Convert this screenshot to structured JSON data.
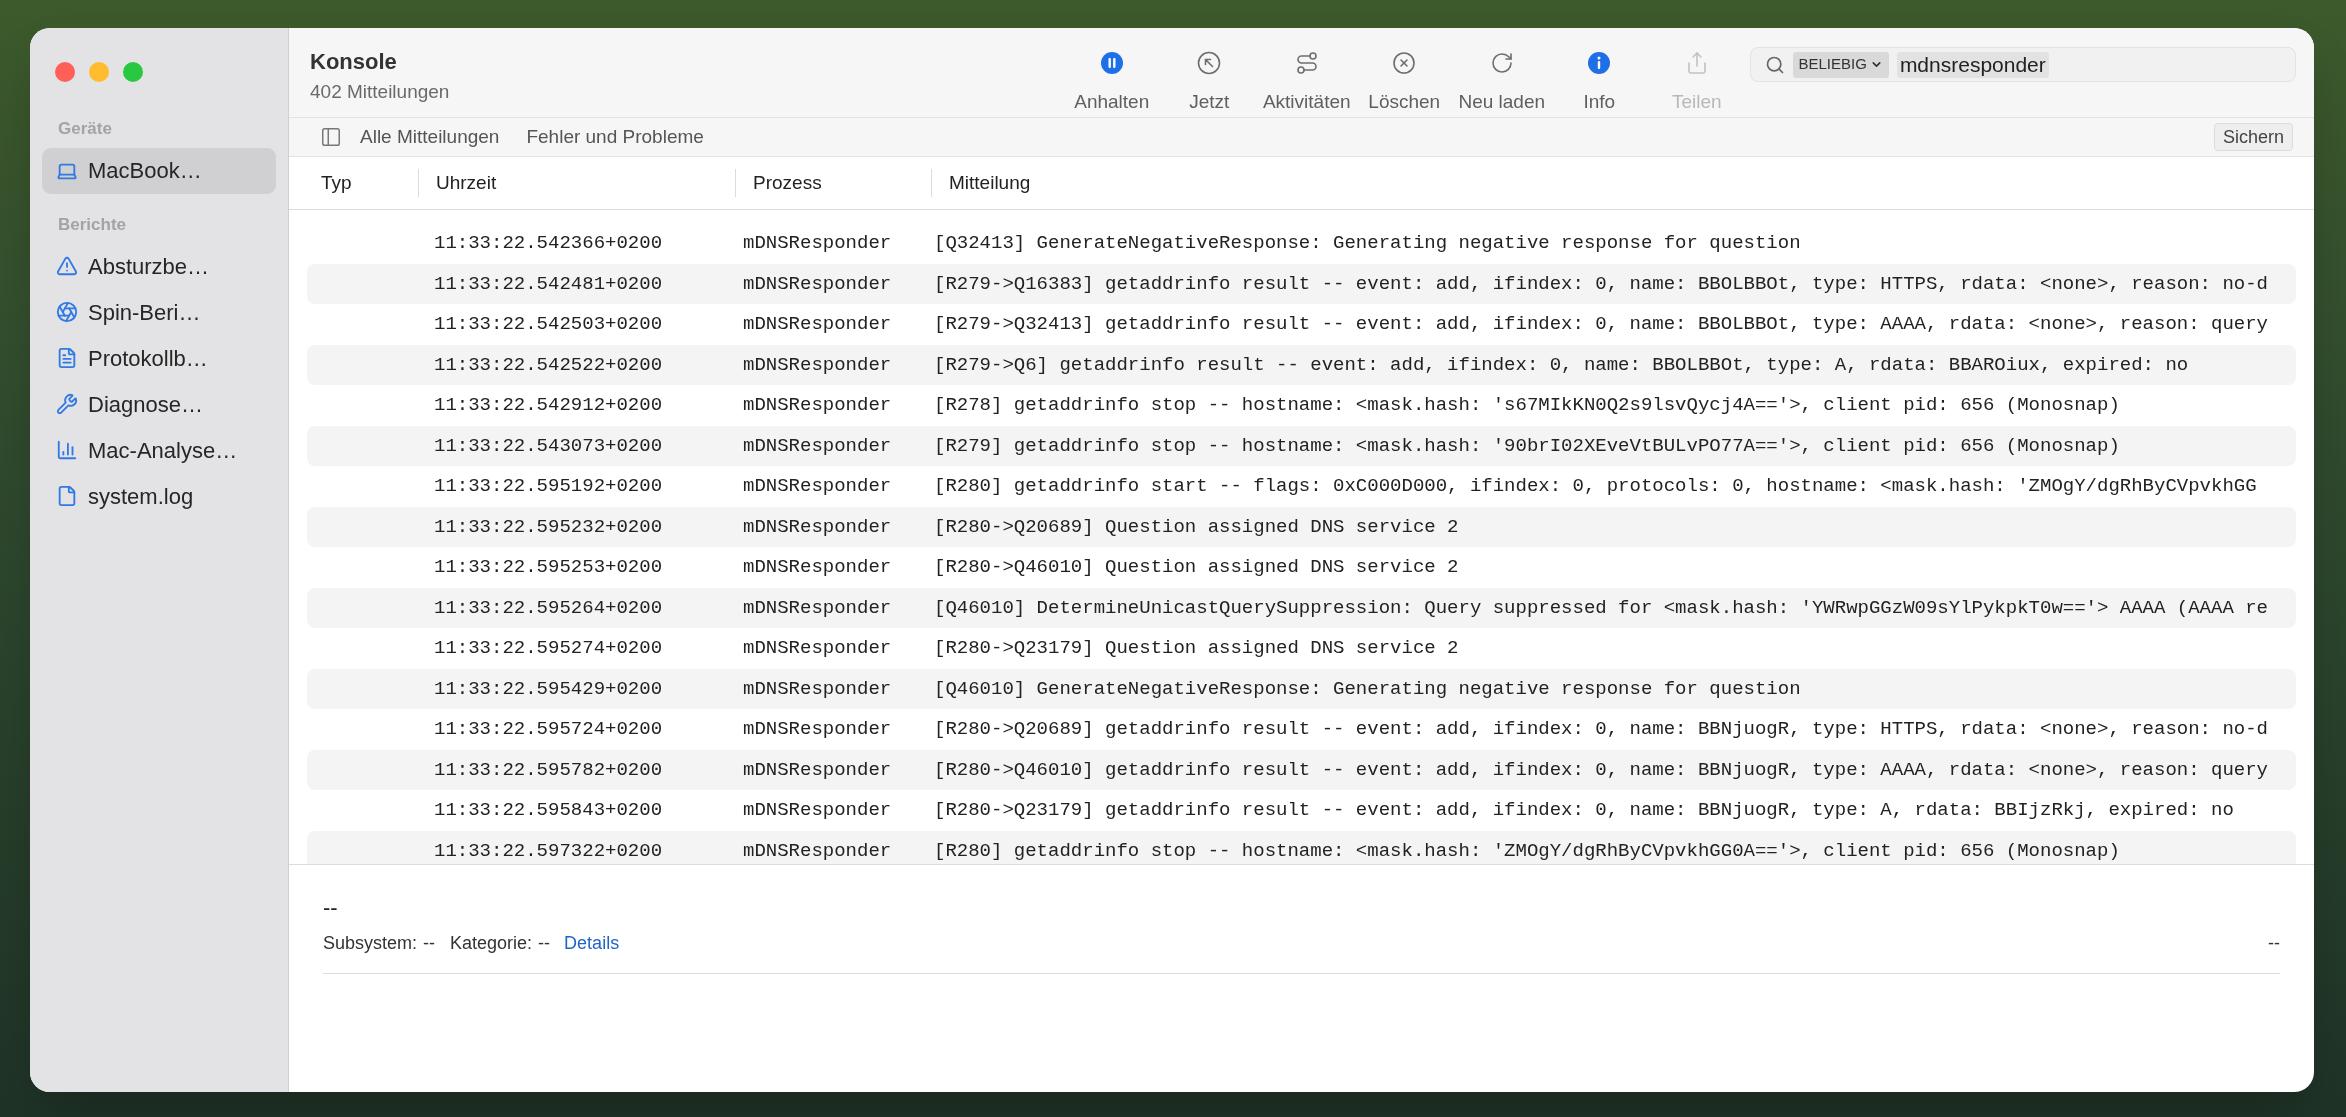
{
  "window": {
    "title": "Konsole",
    "subtitle": "402 Mitteilungen"
  },
  "sidebar": {
    "sections": [
      {
        "title": "Geräte",
        "items": [
          {
            "label": "MacBook…",
            "selected": true
          }
        ]
      },
      {
        "title": "Berichte",
        "items": [
          {
            "label": "Absturzbe…",
            "selected": false
          },
          {
            "label": "Spin-Beri…",
            "selected": false
          },
          {
            "label": "Protokollb…",
            "selected": false
          },
          {
            "label": "Diagnose…",
            "selected": false
          },
          {
            "label": "Mac-Analyse…",
            "selected": false
          },
          {
            "label": "system.log",
            "selected": false
          }
        ]
      }
    ]
  },
  "toolbar": [
    {
      "label": "Anhalten",
      "active": true,
      "disabled": false
    },
    {
      "label": "Jetzt",
      "active": false,
      "disabled": false
    },
    {
      "label": "Aktivitäten",
      "active": false,
      "disabled": false
    },
    {
      "label": "Löschen",
      "active": false,
      "disabled": false
    },
    {
      "label": "Neu laden",
      "active": false,
      "disabled": false
    },
    {
      "label": "Info",
      "active": true,
      "disabled": false
    },
    {
      "label": "Teilen",
      "active": false,
      "disabled": true
    }
  ],
  "search": {
    "scope": "BELIEBIG",
    "value": "mdnsresponder"
  },
  "filters": [
    {
      "label": "Alle Mitteilungen"
    },
    {
      "label": "Fehler und Probleme"
    }
  ],
  "save_button": "Sichern",
  "table": {
    "columns": [
      "Typ",
      "Uhrzeit",
      "Prozess",
      "Mitteilung"
    ],
    "rows": [
      {
        "time": "11:33:22.542366+0200",
        "process": "mDNSResponder",
        "message": "[Q32413] GenerateNegativeResponse: Generating negative response for question"
      },
      {
        "time": "11:33:22.542481+0200",
        "process": "mDNSResponder",
        "message": "[R279->Q16383] getaddrinfo result -- event: add, ifindex: 0, name: BBOLBBOt, type: HTTPS, rdata: <none>, reason: no-d"
      },
      {
        "time": "11:33:22.542503+0200",
        "process": "mDNSResponder",
        "message": "[R279->Q32413] getaddrinfo result -- event: add, ifindex: 0, name: BBOLBBOt, type: AAAA, rdata: <none>, reason: query"
      },
      {
        "time": "11:33:22.542522+0200",
        "process": "mDNSResponder",
        "message": "[R279->Q6] getaddrinfo result -- event: add, ifindex: 0, name: BBOLBBOt, type: A, rdata: BBAROiux, expired: no"
      },
      {
        "time": "11:33:22.542912+0200",
        "process": "mDNSResponder",
        "message": "[R278] getaddrinfo stop -- hostname: <mask.hash: 's67MIkKN0Q2s9lsvQycj4A=='>, client pid: 656 (Monosnap)"
      },
      {
        "time": "11:33:22.543073+0200",
        "process": "mDNSResponder",
        "message": "[R279] getaddrinfo stop -- hostname: <mask.hash: '90brI02XEveVtBULvPO77A=='>, client pid: 656 (Monosnap)"
      },
      {
        "time": "11:33:22.595192+0200",
        "process": "mDNSResponder",
        "message": "[R280] getaddrinfo start -- flags: 0xC000D000, ifindex: 0, protocols: 0, hostname: <mask.hash: 'ZMOgY/dgRhByCVpvkhGG"
      },
      {
        "time": "11:33:22.595232+0200",
        "process": "mDNSResponder",
        "message": "[R280->Q20689] Question assigned DNS service 2"
      },
      {
        "time": "11:33:22.595253+0200",
        "process": "mDNSResponder",
        "message": "[R280->Q46010] Question assigned DNS service 2"
      },
      {
        "time": "11:33:22.595264+0200",
        "process": "mDNSResponder",
        "message": "[Q46010] DetermineUnicastQuerySuppression: Query suppressed for <mask.hash: 'YWRwpGGzW09sYlPykpkT0w=='> AAAA (AAAA re"
      },
      {
        "time": "11:33:22.595274+0200",
        "process": "mDNSResponder",
        "message": "[R280->Q23179] Question assigned DNS service 2"
      },
      {
        "time": "11:33:22.595429+0200",
        "process": "mDNSResponder",
        "message": "[Q46010] GenerateNegativeResponse: Generating negative response for question"
      },
      {
        "time": "11:33:22.595724+0200",
        "process": "mDNSResponder",
        "message": "[R280->Q20689] getaddrinfo result -- event: add, ifindex: 0, name: BBNjuogR, type: HTTPS, rdata: <none>, reason: no-d"
      },
      {
        "time": "11:33:22.595782+0200",
        "process": "mDNSResponder",
        "message": "[R280->Q46010] getaddrinfo result -- event: add, ifindex: 0, name: BBNjuogR, type: AAAA, rdata: <none>, reason: query"
      },
      {
        "time": "11:33:22.595843+0200",
        "process": "mDNSResponder",
        "message": "[R280->Q23179] getaddrinfo result -- event: add, ifindex: 0, name: BBNjuogR, type: A, rdata: BBIjzRkj, expired: no"
      },
      {
        "time": "11:33:22.597322+0200",
        "process": "mDNSResponder",
        "message": "[R280] getaddrinfo stop -- hostname: <mask.hash: 'ZMOgY/dgRhByCVpvkhGG0A=='>, client pid: 656 (Monosnap)"
      }
    ]
  },
  "detail": {
    "title": "--",
    "subsystem_label": "Subsystem:",
    "subsystem": "--",
    "category_label": "Kategorie:",
    "category": "--",
    "link": "Details",
    "right": "--"
  }
}
